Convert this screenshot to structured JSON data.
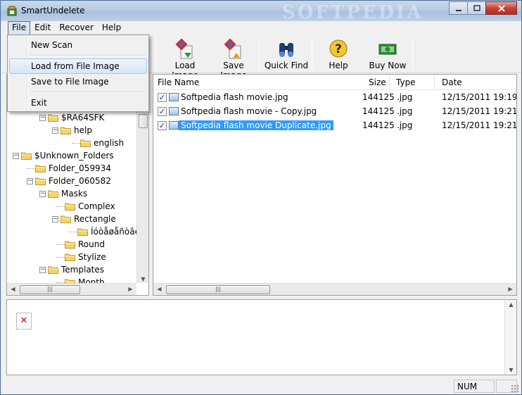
{
  "window": {
    "title": "SmartUndelete",
    "watermark": "SOFTPEDIA"
  },
  "menubar": [
    "File",
    "Edit",
    "Recover",
    "Help"
  ],
  "toolbar": {
    "load_image": "Load Image",
    "save_image": "Save Image",
    "quick_find": "Quick Find",
    "help": "Help",
    "buy_now": "Buy Now"
  },
  "file_menu": {
    "new_scan": "New Scan",
    "load_from_file_image": "Load from File Image",
    "save_to_file_image": "Save to File Image",
    "exit": "Exit"
  },
  "tree": [
    {
      "label": "$RA64SFK",
      "expander": "−"
    },
    {
      "label": "help",
      "expander": "−"
    },
    {
      "label": "english",
      "expander": ""
    },
    {
      "label": "$Unknown_Folders",
      "expander": "−"
    },
    {
      "label": "Folder_059934",
      "expander": ""
    },
    {
      "label": "Folder_060582",
      "expander": "−"
    },
    {
      "label": "Masks",
      "expander": "−"
    },
    {
      "label": "Complex",
      "expander": ""
    },
    {
      "label": "Rectangle",
      "expander": "−"
    },
    {
      "label": "Íóòåøåñòâèÿ",
      "expander": ""
    },
    {
      "label": "Round",
      "expander": ""
    },
    {
      "label": "Stylize",
      "expander": ""
    },
    {
      "label": "Templates",
      "expander": "−"
    },
    {
      "label": "Month",
      "expander": ""
    }
  ],
  "list": {
    "columns": [
      "File Name",
      "Size",
      "Type",
      "Date"
    ],
    "rows": [
      {
        "name": "Softpedia flash movie.jpg",
        "size": "144125",
        "type": ".jpg",
        "date": "12/15/2011 19:19",
        "checked": "✓"
      },
      {
        "name": "Softpedia flash movie - Copy.jpg",
        "size": "144125",
        "type": ".jpg",
        "date": "12/15/2011 19:21",
        "checked": "✓"
      },
      {
        "name": "Softpedia flash movie Duplicate.jpg",
        "size": "144125",
        "type": ".jpg",
        "date": "12/15/2011 19:21",
        "checked": "✓"
      }
    ]
  },
  "status": {
    "num": "NUM"
  },
  "colors": {
    "selection": "#3399ff",
    "folder": "#f3d36b",
    "title_gradient": "#b7cbe3"
  }
}
